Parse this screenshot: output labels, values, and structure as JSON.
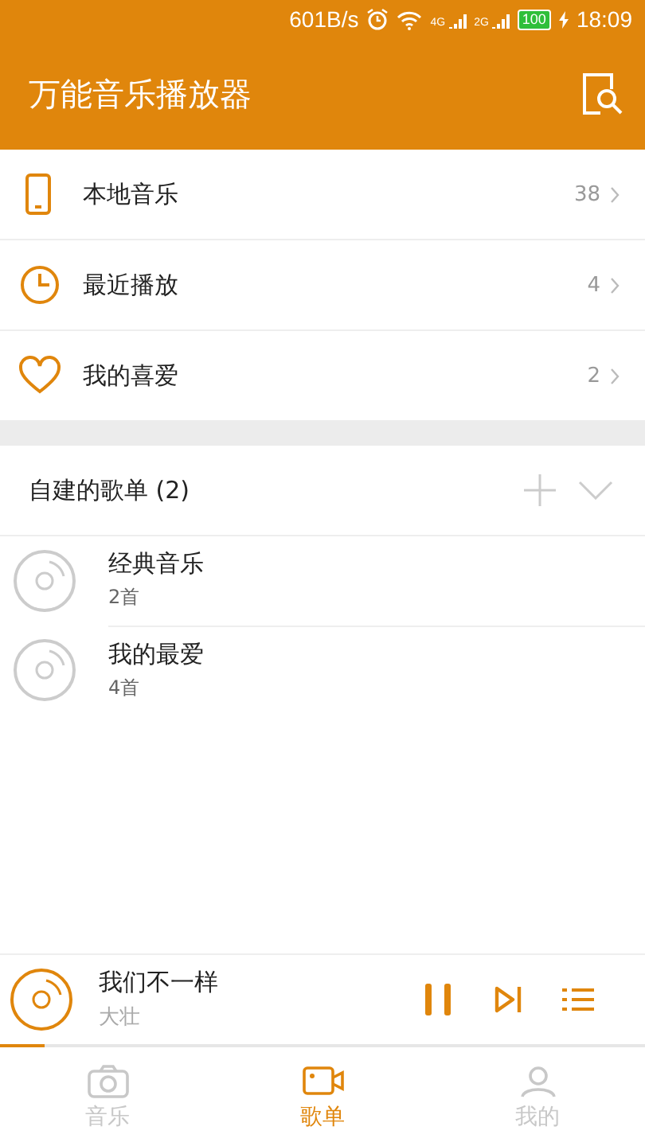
{
  "status_bar": {
    "speed": "601B/s",
    "network_1": "4G",
    "network_2": "2G",
    "battery": "100",
    "time": "18:09"
  },
  "header": {
    "title": "万能音乐播放器"
  },
  "library": [
    {
      "kind": "phone",
      "label": "本地音乐",
      "count": "38"
    },
    {
      "kind": "clock",
      "label": "最近播放",
      "count": "4"
    },
    {
      "kind": "heart",
      "label": "我的喜爱",
      "count": "2"
    }
  ],
  "playlists": {
    "title": "自建的歌单 (2)",
    "items": [
      {
        "name": "经典音乐",
        "count": "2首"
      },
      {
        "name": "我的最爱",
        "count": "4首"
      }
    ]
  },
  "now_playing": {
    "title": "我们不一样",
    "artist": "大壮",
    "level": 0.07,
    "playing": true
  },
  "tabs": [
    {
      "kind": "camera",
      "label": "音乐",
      "selected": false
    },
    {
      "kind": "video",
      "label": "歌单",
      "selected": true
    },
    {
      "kind": "person",
      "label": "我的",
      "selected": false
    }
  ]
}
